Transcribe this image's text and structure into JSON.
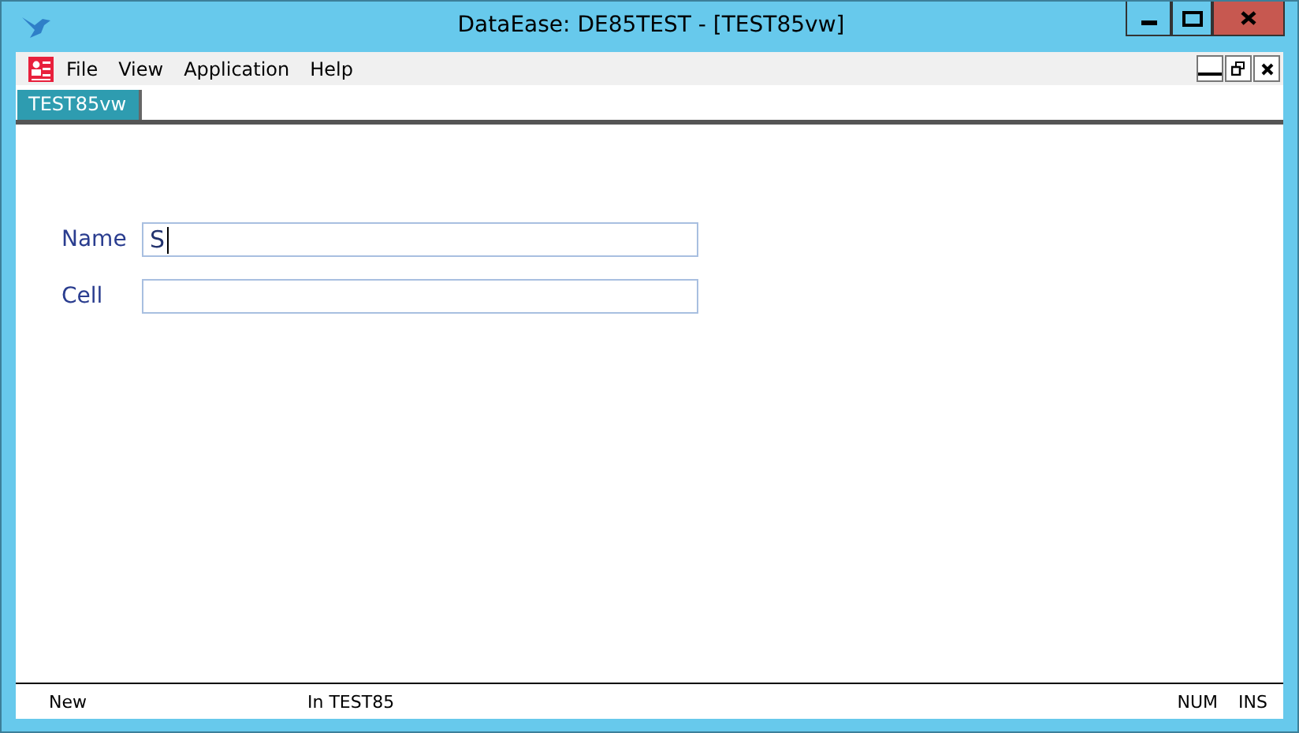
{
  "window": {
    "title": "DataEase: DE85TEST - [TEST85vw]"
  },
  "menu": [
    "File",
    "View",
    "Application",
    "Help"
  ],
  "tabs": [
    {
      "label": "TEST85vw",
      "selected": true
    }
  ],
  "fields": [
    {
      "label": "Name",
      "value": "S",
      "focused": true
    },
    {
      "label": "Cell",
      "focused": false
    }
  ],
  "status_bar": {
    "mode": "New",
    "location": "In TEST85",
    "indicators": [
      "NUM",
      "INS"
    ]
  }
}
